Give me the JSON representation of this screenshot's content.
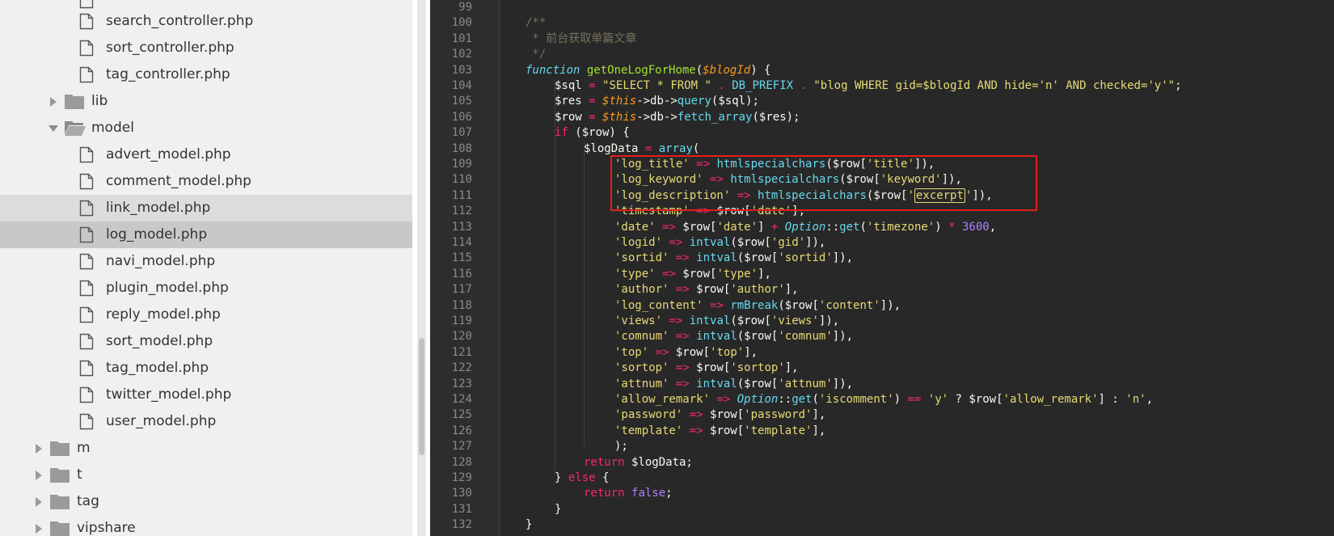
{
  "file_tree": {
    "items": [
      {
        "name": "search_controller.php",
        "type": "file"
      },
      {
        "name": "sort_controller.php",
        "type": "file"
      },
      {
        "name": "tag_controller.php",
        "type": "file"
      },
      {
        "name": "lib",
        "type": "folder",
        "state": "collapsed"
      },
      {
        "name": "model",
        "type": "folder",
        "state": "expanded"
      },
      {
        "name": "advert_model.php",
        "type": "file"
      },
      {
        "name": "comment_model.php",
        "type": "file"
      },
      {
        "name": "link_model.php",
        "type": "file",
        "state": "hover"
      },
      {
        "name": "log_model.php",
        "type": "file",
        "state": "selected"
      },
      {
        "name": "navi_model.php",
        "type": "file"
      },
      {
        "name": "plugin_model.php",
        "type": "file"
      },
      {
        "name": "reply_model.php",
        "type": "file"
      },
      {
        "name": "sort_model.php",
        "type": "file"
      },
      {
        "name": "tag_model.php",
        "type": "file"
      },
      {
        "name": "twitter_model.php",
        "type": "file"
      },
      {
        "name": "user_model.php",
        "type": "file"
      },
      {
        "name": "m",
        "type": "folder",
        "state": "collapsed"
      },
      {
        "name": "t",
        "type": "folder",
        "state": "collapsed"
      },
      {
        "name": "tag",
        "type": "folder",
        "state": "collapsed"
      },
      {
        "name": "vipshare",
        "type": "folder",
        "state": "collapsed"
      }
    ]
  },
  "editor": {
    "line_numbers": [
      "99",
      "100",
      "101",
      "102",
      "103",
      "104",
      "105",
      "106",
      "107",
      "108",
      "109",
      "110",
      "111",
      "112",
      "113",
      "114",
      "115",
      "116",
      "117",
      "118",
      "119",
      "120",
      "121",
      "122",
      "123",
      "124",
      "125",
      "126",
      "127",
      "128",
      "129",
      "130",
      "131",
      "132"
    ],
    "highlighted_lines": [
      "109",
      "110",
      "111"
    ],
    "highlighted_word": "excerpt",
    "lines": {
      "l99": "",
      "l100": "/**",
      "l101": " * 前台获取单篇文章",
      "l102": " */",
      "l103_kw": "function",
      "l103_fn": "getOneLogForHome",
      "l103_param": "$blogId",
      "l104_str1": "\"SELECT * FROM \"",
      "l104_const": "DB_PREFIX",
      "l104_str2": "\"blog WHERE gid=$blogId AND hide='n' AND checked='y'\"",
      "l105_call": "query",
      "l106_call": "fetch_array",
      "l108_call": "array",
      "l109_key": "'log_title'",
      "l109_call": "htmlspecialchars",
      "l109_idx": "'title'",
      "l110_key": "'log_keyword'",
      "l110_call": "htmlspecialchars",
      "l110_idx": "'keyword'",
      "l111_key": "'log_description'",
      "l111_call": "htmlspecialchars",
      "l112_key": "'timestamp'",
      "l112_idx": "'date'",
      "l113_key": "'date'",
      "l113_idx": "'date'",
      "l113_class": "Option",
      "l113_call": "get",
      "l113_arg": "'timezone'",
      "l113_num": "3600",
      "l114_key": "'logid'",
      "l114_call": "intval",
      "l114_idx": "'gid'",
      "l115_key": "'sortid'",
      "l115_call": "intval",
      "l115_idx": "'sortid'",
      "l116_key": "'type'",
      "l116_idx": "'type'",
      "l117_key": "'author'",
      "l117_idx": "'author'",
      "l118_key": "'log_content'",
      "l118_call": "rmBreak",
      "l118_idx": "'content'",
      "l119_key": "'views'",
      "l119_call": "intval",
      "l119_idx": "'views'",
      "l120_key": "'comnum'",
      "l120_call": "intval",
      "l120_idx": "'comnum'",
      "l121_key": "'top'",
      "l121_idx": "'top'",
      "l122_key": "'sortop'",
      "l122_idx": "'sortop'",
      "l123_key": "'attnum'",
      "l123_call": "intval",
      "l123_idx": "'attnum'",
      "l124_key": "'allow_remark'",
      "l124_class": "Option",
      "l124_call": "get",
      "l124_arg": "'iscomment'",
      "l124_y": "'y'",
      "l124_idx": "'allow_remark'",
      "l124_n": "'n'",
      "l125_key": "'password'",
      "l125_idx": "'password'",
      "l126_key": "'template'",
      "l126_idx": "'template'",
      "l127": ");",
      "l128_kw": "return",
      "l129_kw": "else",
      "l130_kw": "return",
      "l130_val": "false",
      "l131": "}",
      "l132": "}"
    }
  },
  "colors": {
    "editor_bg": "#282828",
    "gutter_bg": "#2d2d2d",
    "tree_bg": "#f0f0f0",
    "tree_selected": "#c8c8c8",
    "highlight_box": "#e81c1c",
    "keyword": "#f92672",
    "string": "#e6db74",
    "builtin": "#66d9ef",
    "comment": "#75715e",
    "number": "#ae81ff",
    "parameter": "#fd971f"
  }
}
